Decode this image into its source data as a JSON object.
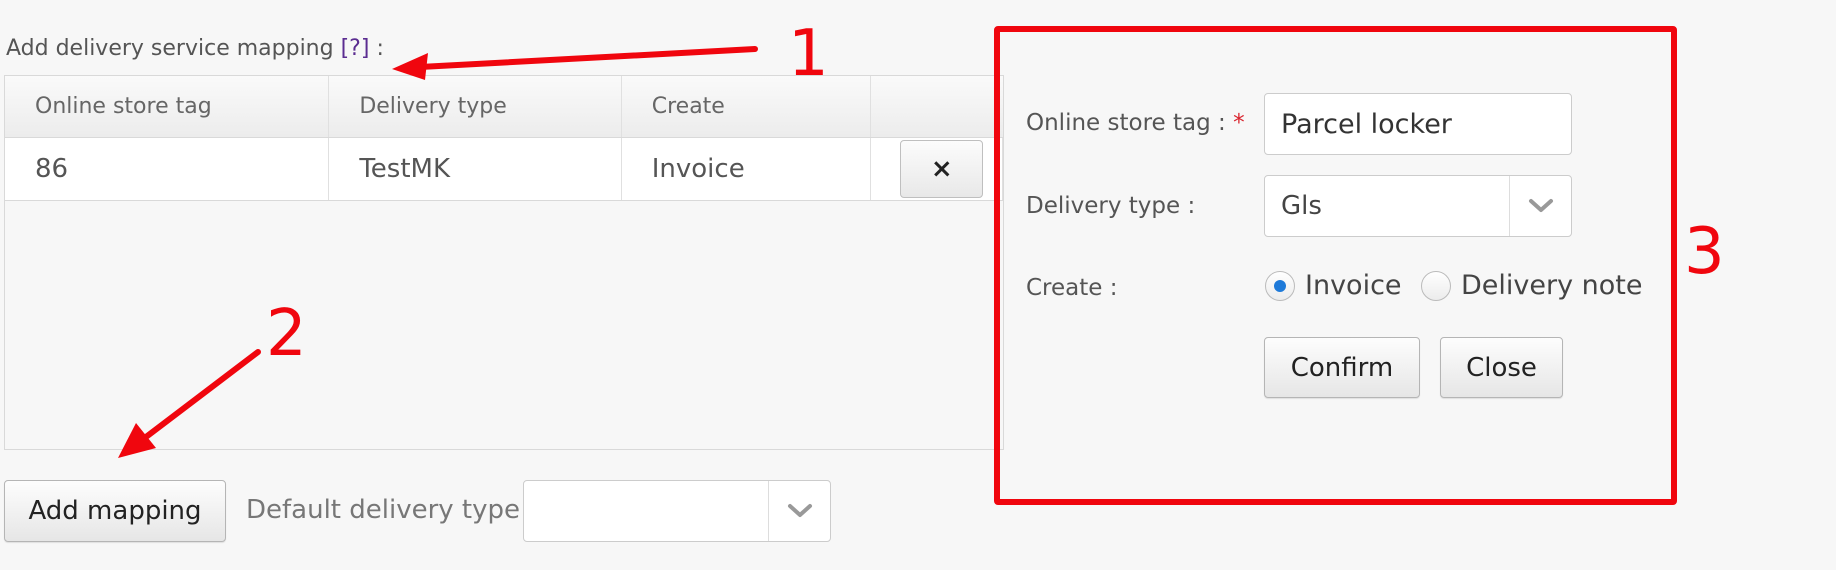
{
  "mapping_section": {
    "title": "Add delivery service mapping",
    "help_link": "[?]",
    "title_suffix": ":"
  },
  "table": {
    "headers": [
      "Online store tag",
      "Delivery type",
      "Create",
      ""
    ],
    "rows": [
      {
        "store_tag": "86",
        "delivery_type": "TestMK",
        "create": "Invoice",
        "delete_label": "×"
      }
    ]
  },
  "bottom": {
    "add_mapping_label": "Add mapping",
    "default_delivery_label": "Default delivery type :",
    "default_delivery_value": ""
  },
  "form": {
    "store_tag_label": "Online store tag :",
    "required_mark": "*",
    "store_tag_value": "Parcel locker",
    "delivery_type_label": "Delivery type :",
    "delivery_type_value": "Gls",
    "create_label": "Create :",
    "create_options": [
      {
        "label": "Invoice",
        "selected": true
      },
      {
        "label": "Delivery note",
        "selected": false
      }
    ],
    "confirm_label": "Confirm",
    "close_label": "Close"
  },
  "annotations": {
    "color": "#f0060e",
    "labels": [
      "1",
      "2",
      "3"
    ]
  },
  "icons": {
    "dropdown": "chevron-down-icon",
    "delete": "close-icon"
  }
}
